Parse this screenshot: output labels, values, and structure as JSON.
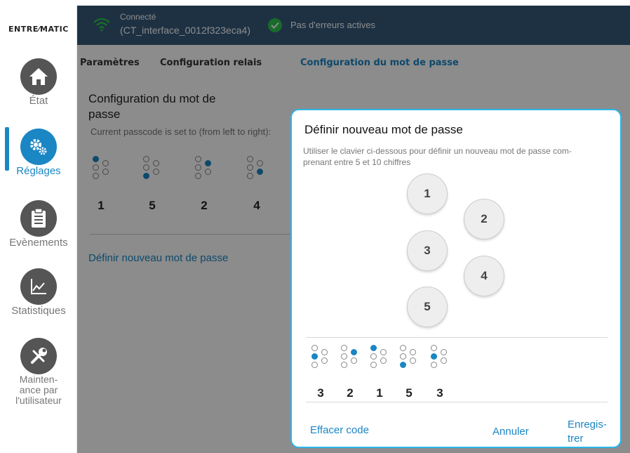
{
  "sidebar": {
    "logo": "ENTRE⁄MATIC",
    "items": [
      {
        "label": "État",
        "icon": "home-icon"
      },
      {
        "label": "Réglages",
        "icon": "gears-icon"
      },
      {
        "label": "Evènements",
        "icon": "clipboard-icon"
      },
      {
        "label": "Statistiques",
        "icon": "chart-icon"
      },
      {
        "label_lines": [
          "Mainten-",
          "ance par",
          "l'utilisateur"
        ],
        "icon": "tools-icon"
      }
    ],
    "active_color": "#1a86c4"
  },
  "status": {
    "connected_label": "Connecté",
    "connection_name": "(CT_interface_0012f323eca4)",
    "errors_text": "Pas d'erreurs actives",
    "bar_color": "#35597a"
  },
  "tabs": [
    {
      "label": "Paramètres"
    },
    {
      "label": "Configuration relais"
    },
    {
      "label": "Configuration du mot de passe",
      "active": true
    }
  ],
  "content": {
    "title": "Configuration du mot de passe",
    "current_info": "Current passcode is set to (from left to right):",
    "current_digits": [
      "1",
      "5",
      "2",
      "4"
    ],
    "define_link": "Définir nouveau mot de passe"
  },
  "dialog": {
    "title": "Définir nouveau mot de passe",
    "help_lines": [
      "Utiliser le clavier ci-dessous pour définir un nouveau mot de passe com-",
      "prenant entre 5 et 10 chiffres"
    ],
    "keys": [
      "1",
      "2",
      "3",
      "4",
      "5"
    ],
    "new_digits": [
      "3",
      "2",
      "1",
      "5",
      "3"
    ],
    "clear_button": "Effacer code",
    "cancel_button": "Annuler",
    "save_lines": [
      "Enregis-",
      "trer"
    ],
    "border_color": "#29b6e8"
  }
}
